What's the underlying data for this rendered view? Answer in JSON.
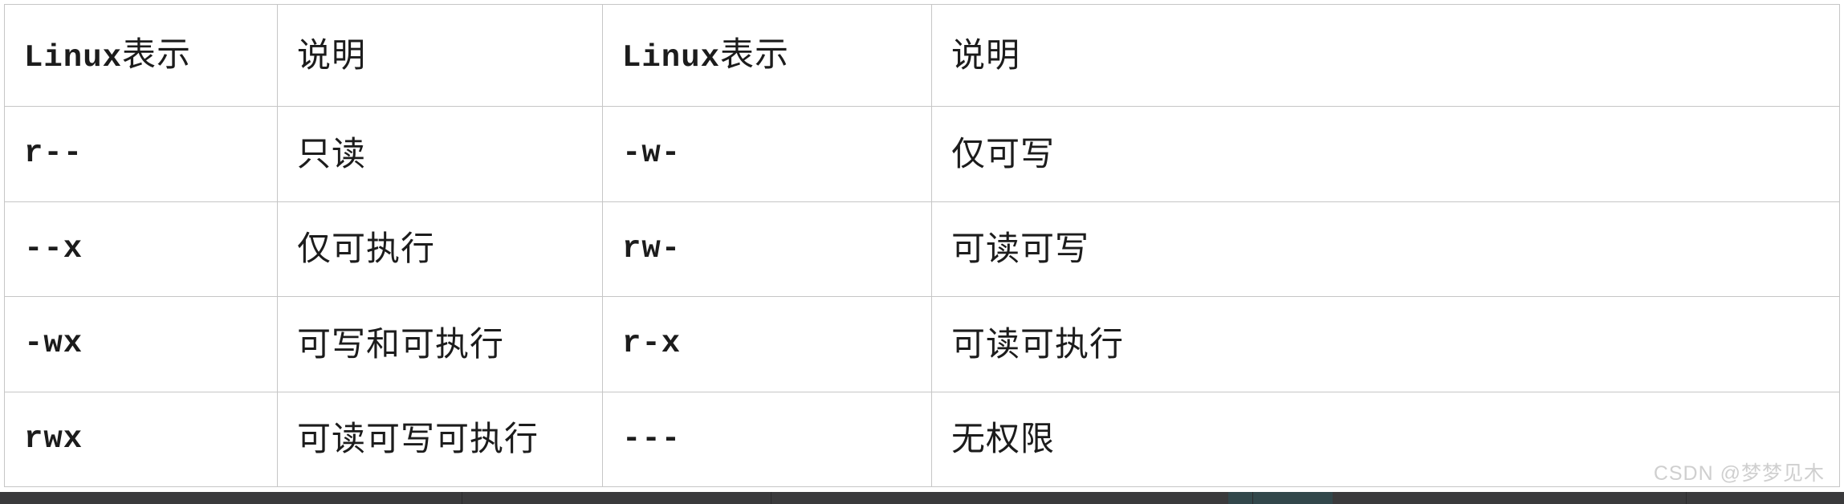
{
  "table": {
    "columns": [
      {
        "key": "notation_left",
        "header_ascii": "Linux",
        "header_cjk": "表示"
      },
      {
        "key": "description_left",
        "header_cjk": "说明"
      },
      {
        "key": "notation_right",
        "header_ascii": "Linux",
        "header_cjk": "表示"
      },
      {
        "key": "description_right",
        "header_cjk": "说明"
      }
    ],
    "rows": [
      {
        "notation_left": "r--",
        "description_left": "只读",
        "notation_right": "-w-",
        "description_right": "仅可写"
      },
      {
        "notation_left": "--x",
        "description_left": "仅可执行",
        "notation_right": "rw-",
        "description_right": "可读可写"
      },
      {
        "notation_left": "-wx",
        "description_left": "可写和可执行",
        "notation_right": "r-x",
        "description_right": "可读可执行"
      },
      {
        "notation_left": "rwx",
        "description_left": "可读可写可执行",
        "notation_right": "---",
        "description_right": "无权限"
      }
    ]
  },
  "watermark": {
    "text": "CSDN @梦梦见木"
  },
  "colors": {
    "border": "#c6c6c6",
    "text": "#1c1c1c",
    "background": "#ffffff",
    "watermark": "#cfcfcf",
    "bottom_bar": "#3a3a3c"
  }
}
